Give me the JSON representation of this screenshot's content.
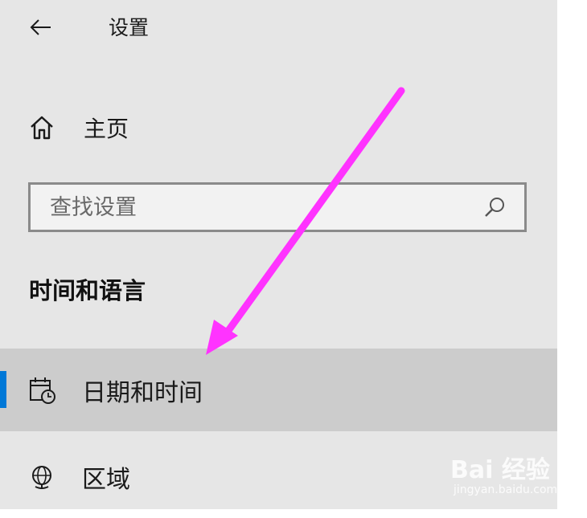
{
  "header": {
    "title": "设置",
    "back_icon": "arrow-left-icon"
  },
  "home": {
    "label": "主页",
    "icon": "home-icon"
  },
  "search": {
    "placeholder": "查找设置",
    "value": "",
    "icon": "search-icon"
  },
  "section": {
    "title": "时间和语言"
  },
  "nav": {
    "items": [
      {
        "label": "日期和时间",
        "icon": "calendar-clock-icon",
        "selected": true
      },
      {
        "label": "区域",
        "icon": "globe-icon",
        "selected": false
      }
    ]
  },
  "annotation": {
    "arrow_color": "#ff33ff"
  },
  "colors": {
    "accent": "#0078d7",
    "selected_bg": "#cccccc",
    "panel_bg": "#e6e6e6"
  },
  "watermark": {
    "text": "Bai 经验",
    "url_text": "jingyan.baidu.com"
  }
}
